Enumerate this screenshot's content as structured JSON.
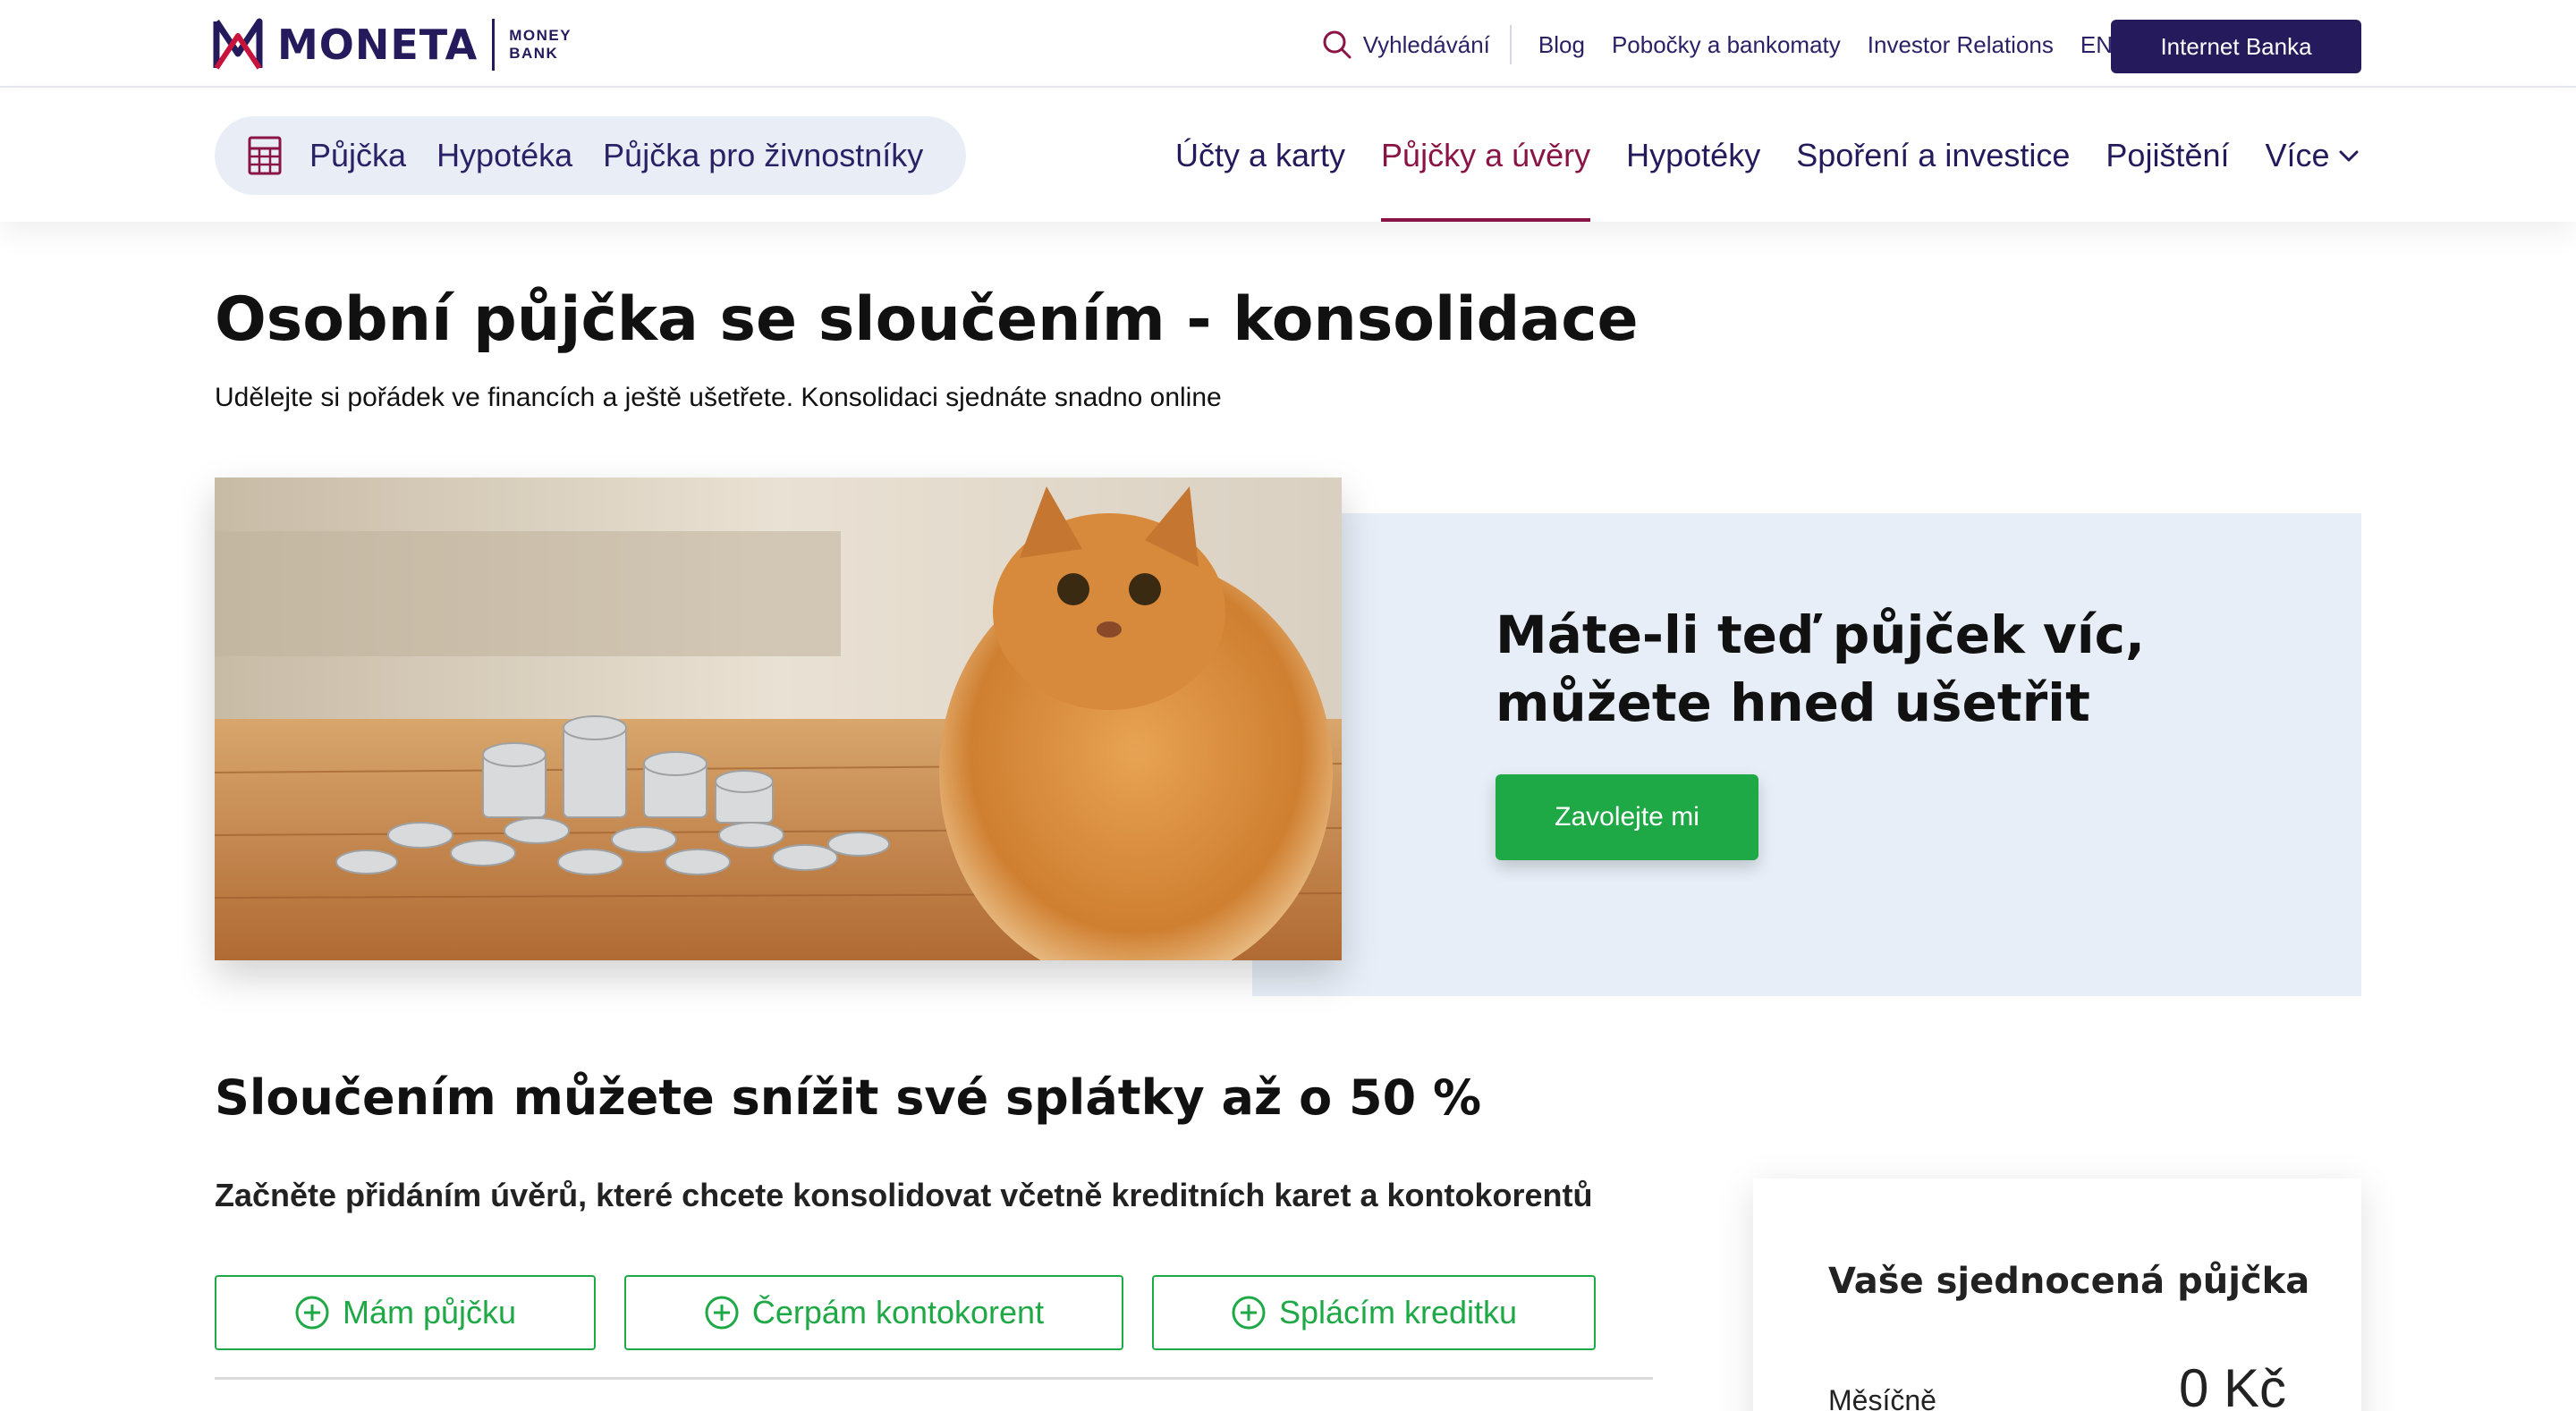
{
  "brand": {
    "name": "MONETA",
    "sub_line1": "MONEY",
    "sub_line2": "BANK",
    "color_primary": "#241a5c",
    "color_accent": "#8a1446",
    "color_green": "#1ea846"
  },
  "topbar": {
    "search_label": "Vyhledávání",
    "links": [
      "Blog",
      "Pobočky a bankomaty",
      "Investor Relations",
      "EN"
    ],
    "internet_bank_label": "Internet Banka"
  },
  "quicklinks": {
    "icon": "calculator-icon",
    "items": [
      "Půjčka",
      "Hypotéka",
      "Půjčka pro živnostníky"
    ]
  },
  "mainnav": {
    "items": [
      "Účty a karty",
      "Půjčky a úvěry",
      "Hypotéky",
      "Spoření a investice",
      "Pojištění"
    ],
    "active_item": "Půjčky a úvěry",
    "more_label": "Více"
  },
  "page": {
    "title": "Osobní půjčka se sloučením - konsolidace",
    "subtitle": "Udělejte si pořádek ve financích a ještě ušetřete. Konsolidaci sjednáte snadno online"
  },
  "hero": {
    "heading_line1": "Máte-li teď půjček víc,",
    "heading_line2": "můžete hned ušetřit",
    "cta_label": "Zavolejte mi"
  },
  "consolidation": {
    "title": "Sloučením můžete snížit své splátky až o 50 %",
    "subtitle": "Začněte přidáním úvěrů, které chcete konsolidovat včetně kreditních karet a kontokorentů",
    "buttons": [
      "Mám půjčku",
      "Čerpám kontokorent",
      "Splácím kreditku"
    ]
  },
  "result": {
    "title": "Vaše sjednocená půjčka",
    "monthly_label": "Měsíčně",
    "monthly_value": "0 Kč"
  }
}
